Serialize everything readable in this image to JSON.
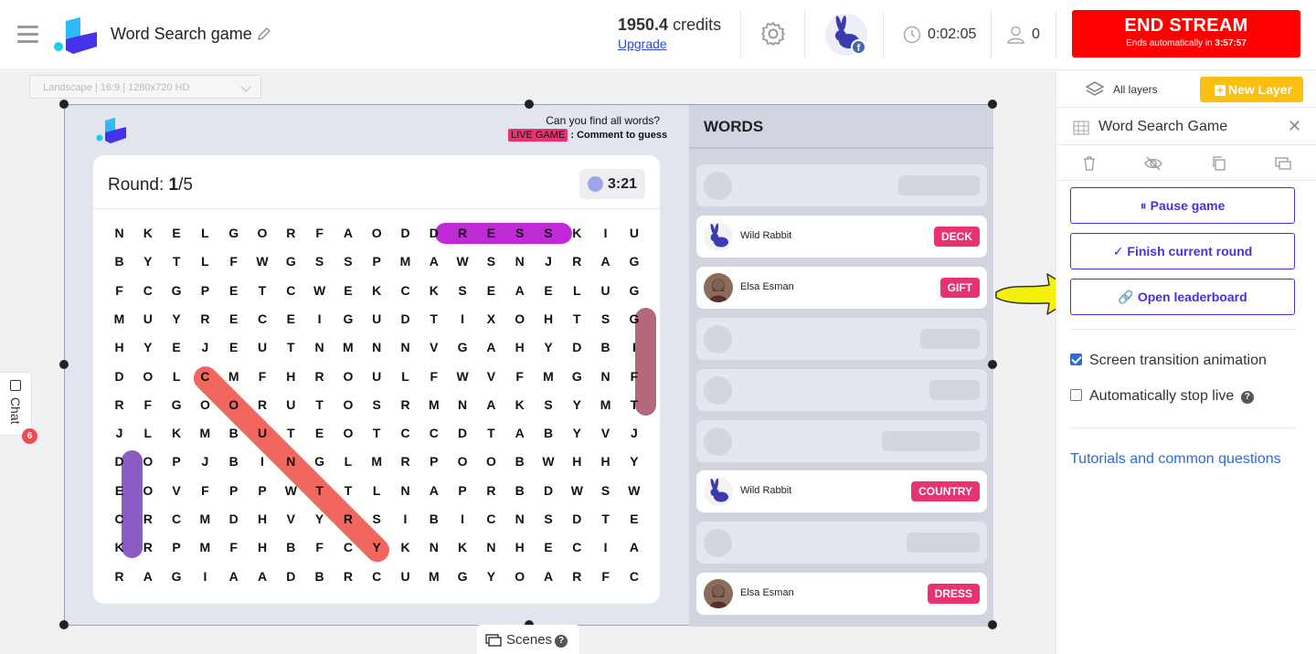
{
  "header": {
    "title": "Word Search game",
    "credits_value": "1950.4",
    "credits_unit": "credits",
    "upgrade_label": "Upgrade",
    "timer": "0:02:05",
    "viewer_count": "0",
    "end_stream_label": "END STREAM",
    "end_stream_sub_prefix": "Ends automatically in ",
    "end_stream_sub_time": "3:57:57",
    "avatar_badge": "f"
  },
  "workspace": {
    "resolution_select": "Landscape | 16:9 | 1280x720 HD",
    "chat_label": "Chat",
    "chat_badge": "6",
    "scenes_label": "Scenes",
    "scenes_help": "?"
  },
  "game": {
    "question": "Can you find all words?",
    "live_badge": "LIVE GAME",
    "instruction": ": Comment to guess",
    "round_label": "Round: ",
    "round_current": "1",
    "round_total": "/5",
    "time_left": "3:21",
    "words_header": "WORDS",
    "grid": [
      "NKELGORFAODDRESSKIU",
      "BYTLFWGSSPMAWSNJRAG",
      "FCGPETCWEKCKSEAELUG",
      "MUYRECEIGUDTIXOHTSG",
      "HYEJEUTNMNNVGAHYDBI",
      "DOLCMFHROULFWVFMGNF",
      "RFGOORUTOSRMNAKSYMT",
      "JLKMBUTEOTCCDTABYVJ",
      "DOPJBINGLMRPOOBWHHY",
      "EOVFPPWTTLNAPRBDWSW",
      "CRCMDHVYRSIBICNSDTE",
      "KRPMFHBFCYKNKNHECIA",
      "RAGIAADBRCUMGYOARFC"
    ],
    "found_words": [
      {
        "word": "DRESS",
        "color": "#c02ad6"
      },
      {
        "word": "GIFT",
        "color": "#b4687b"
      },
      {
        "word": "DECK",
        "color": "#8a5cc4"
      },
      {
        "word": "COUNTRY",
        "color": "#f26660"
      }
    ],
    "slots": [
      {
        "filled": false
      },
      {
        "filled": true,
        "name": "Wild Rabbit",
        "word": "DECK"
      },
      {
        "filled": true,
        "name": "Elsa Esman",
        "word": "GIFT"
      },
      {
        "filled": false
      },
      {
        "filled": false
      },
      {
        "filled": false
      },
      {
        "filled": true,
        "name": "Wild Rabbit",
        "word": "COUNTRY"
      },
      {
        "filled": false
      },
      {
        "filled": true,
        "name": "Elsa Esman",
        "word": "DRESS"
      }
    ]
  },
  "panel": {
    "all_layers": "All layers",
    "new_layer": "New Layer",
    "layer_name": "Word Search Game",
    "pause_label": "Pause game",
    "finish_label": "Finish current round",
    "leaderboard_label": "Open leaderboard",
    "opt_transition": "Screen transition animation",
    "opt_transition_checked": true,
    "opt_autostop": "Automatically stop live",
    "opt_autostop_checked": false,
    "tutorials": "Tutorials and common questions"
  },
  "colors": {
    "accent": "#4b2ee3",
    "end_stream": "#ff0000",
    "new_layer": "#fbbf12",
    "word_tag": "#e8336f",
    "link": "#2b6bd6"
  }
}
